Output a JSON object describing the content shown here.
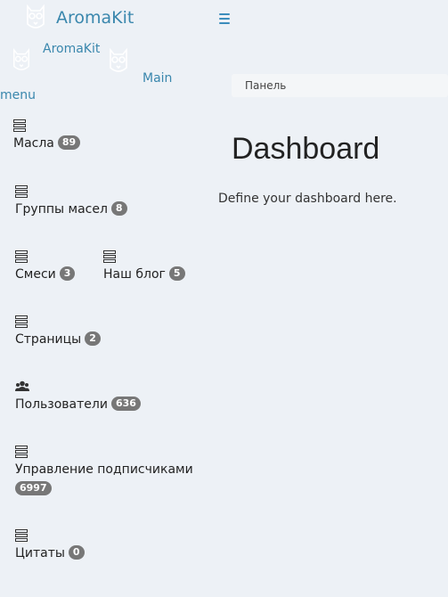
{
  "header": {
    "brand_name": "AromaKit",
    "sub_brand": "AromaKit",
    "main_menu_label": "Main",
    "main_menu_label_2": "menu"
  },
  "breadcrumb": {
    "label": "Панель"
  },
  "main": {
    "title": "Dashboard",
    "description": "Define your dashboard here."
  },
  "sidebar": {
    "items": [
      {
        "label": "Масла",
        "badge": "89",
        "icon": "database-icon"
      },
      {
        "label": "Группы масел",
        "badge": "8",
        "icon": "database-icon"
      },
      {
        "label": "Смеси",
        "badge": "3",
        "icon": "database-icon"
      },
      {
        "label": "Наш блог",
        "badge": "5",
        "icon": "database-icon"
      },
      {
        "label": "Страницы",
        "badge": "2",
        "icon": "database-icon"
      },
      {
        "label": "Пользователи",
        "badge": "636",
        "icon": "users-icon"
      },
      {
        "label": "Управление подписчиками",
        "badge": "6997",
        "icon": "database-icon"
      },
      {
        "label": "Цитаты",
        "badge": "0",
        "icon": "database-icon"
      }
    ]
  },
  "colors": {
    "background": "#edf1f6",
    "link": "#3a87ad",
    "badge": "#777777",
    "hamburger": "#3c8dbc"
  }
}
